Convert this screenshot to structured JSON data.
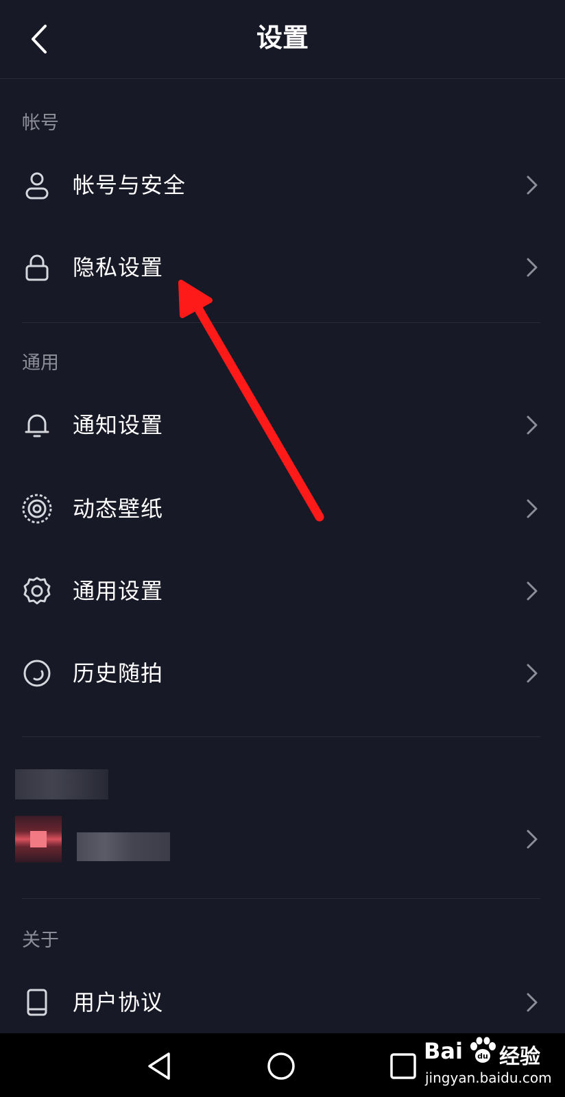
{
  "header": {
    "title": "设置",
    "back_icon": "chevron-left-icon"
  },
  "sections": {
    "account": {
      "label": "帐号",
      "items": [
        {
          "label": "帐号与安全",
          "icon": "user-icon"
        },
        {
          "label": "隐私设置",
          "icon": "lock-icon"
        }
      ]
    },
    "general": {
      "label": "通用",
      "items": [
        {
          "label": "通知设置",
          "icon": "bell-icon"
        },
        {
          "label": "动态壁纸",
          "icon": "live-wallpaper-icon"
        },
        {
          "label": "通用设置",
          "icon": "gear-icon"
        },
        {
          "label": "历史随拍",
          "icon": "history-icon"
        }
      ]
    },
    "about": {
      "label": "关于",
      "items": [
        {
          "label": "用户协议",
          "icon": "book-icon"
        }
      ]
    }
  },
  "nav": {
    "back": "triangle-back-icon",
    "home": "circle-home-icon",
    "recent": "square-recent-icon"
  },
  "watermark": {
    "brand": "Bai",
    "brand_suffix": "经验",
    "url": "jingyan.baidu.com"
  },
  "colors": {
    "background": "#181926",
    "arrow": "#ff1a1a",
    "section_label": "#8d8e98"
  }
}
